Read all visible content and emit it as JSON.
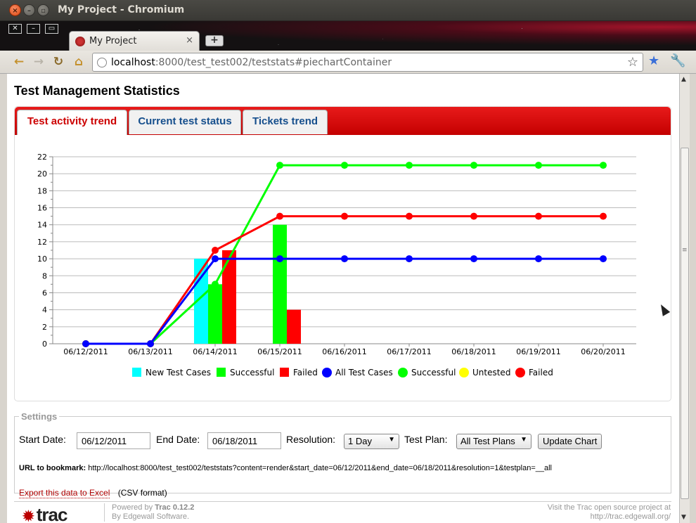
{
  "window": {
    "title": "My Project - Chromium"
  },
  "browser": {
    "tab_title": "My Project",
    "tab_close": "×",
    "new_tab": "+",
    "url_host": "localhost",
    "url_rest": ":8000/test_test002/teststats#piechartContainer",
    "win_controls": [
      "✕",
      "–",
      "▭"
    ]
  },
  "page": {
    "title": "Test Management Statistics",
    "tabs": [
      {
        "label": "Test activity trend",
        "active": true
      },
      {
        "label": "Current test status",
        "active": false
      },
      {
        "label": "Tickets trend",
        "active": false
      }
    ]
  },
  "chart_data": {
    "type": "bar+line",
    "categories": [
      "06/12/2011",
      "06/13/2011",
      "06/14/2011",
      "06/15/2011",
      "06/16/2011",
      "06/17/2011",
      "06/18/2011",
      "06/19/2011",
      "06/20/2011"
    ],
    "ylim": [
      0,
      22
    ],
    "yticks": [
      0,
      2,
      4,
      6,
      8,
      10,
      12,
      14,
      16,
      18,
      20,
      22
    ],
    "grid": true,
    "legend_placement": "bottom",
    "bar_series": [
      {
        "name": "New Test Cases",
        "color": "#00ffff",
        "values": [
          0,
          0,
          10,
          0,
          0,
          0,
          0,
          0,
          0
        ]
      },
      {
        "name": "Successful",
        "color": "#00ff00",
        "values": [
          0,
          0,
          7,
          14,
          0,
          0,
          0,
          0,
          0
        ]
      },
      {
        "name": "Failed",
        "color": "#ff0000",
        "values": [
          0,
          0,
          11,
          4,
          0,
          0,
          0,
          0,
          0
        ]
      }
    ],
    "line_series": [
      {
        "name": "All Test Cases",
        "color": "#0000ff",
        "values": [
          0,
          0,
          10,
          10,
          10,
          10,
          10,
          10,
          10
        ]
      },
      {
        "name": "Successful",
        "color": "#00ff00",
        "values": [
          0,
          0,
          7,
          21,
          21,
          21,
          21,
          21,
          21
        ]
      },
      {
        "name": "Untested",
        "color": "#ffff00",
        "values": [
          null,
          null,
          null,
          null,
          null,
          null,
          null,
          null,
          null
        ]
      },
      {
        "name": "Failed",
        "color": "#ff0000",
        "values": [
          0,
          0,
          11,
          15,
          15,
          15,
          15,
          15,
          15
        ]
      }
    ]
  },
  "settings": {
    "legend": "Settings",
    "start_date_label": "Start Date:",
    "start_date": "06/12/2011",
    "end_date_label": "End Date:",
    "end_date": "06/18/2011",
    "resolution_label": "Resolution:",
    "resolution": "1 Day",
    "test_plan_label": "Test Plan:",
    "test_plan": "All Test Plans",
    "update_button": "Update Chart",
    "bookmark_label": "URL to bookmark:",
    "bookmark_url": "http://localhost:8000/test_test002/teststats?content=render&start_date=06/12/2011&end_date=06/18/2011&resolution=1&testplan=__all",
    "export_link": "Export this data to Excel",
    "export_note": "(CSV format)"
  },
  "footer": {
    "logo": "trac",
    "powered_by": "Powered by",
    "trac_version": "Trac 0.12.2",
    "by_line": "By Edgewall Software.",
    "visit_line1": "Visit the Trac open source project at",
    "visit_line2": "http://trac.edgewall.org/"
  }
}
